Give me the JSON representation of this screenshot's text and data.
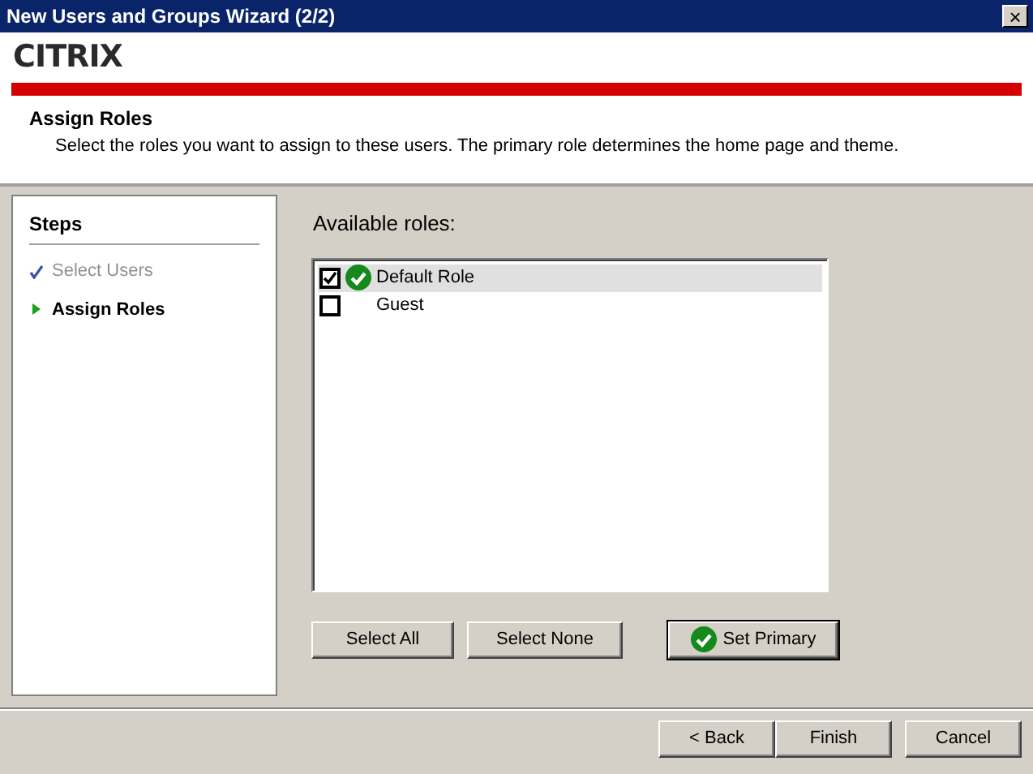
{
  "window": {
    "title": "New Users and Groups Wizard (2/2)",
    "close": "×"
  },
  "logo": {
    "text": "CITRIX"
  },
  "header": {
    "title": "Assign Roles",
    "description": "Select the roles you want to assign to these users. The primary role determines the home page and theme."
  },
  "steps": {
    "title": "Steps",
    "items": [
      {
        "label": "Select Users",
        "completed": true,
        "selected": false
      },
      {
        "label": "Assign Roles",
        "completed": false,
        "selected": true
      }
    ]
  },
  "roles": {
    "label": "Available roles:",
    "items": [
      {
        "name": "Default Role",
        "checked": true,
        "primary": true,
        "selected": true
      },
      {
        "name": "Guest",
        "checked": false,
        "primary": false,
        "selected": false
      }
    ]
  },
  "role_buttons": [
    {
      "label": "Select All",
      "kind": "plain"
    },
    {
      "label": "Select None",
      "kind": "plain"
    },
    {
      "label": "Set Primary",
      "kind": "primary"
    }
  ],
  "footer_buttons": [
    "< Back",
    "Finish",
    "Cancel"
  ]
}
